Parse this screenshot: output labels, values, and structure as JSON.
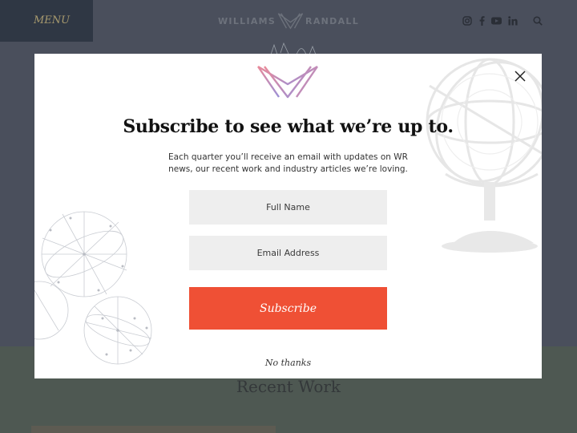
{
  "header": {
    "menu_label": "MENU",
    "logo": {
      "left_word": "WILLIAMS",
      "right_word": "RANDALL"
    },
    "social_icons": [
      "instagram-icon",
      "facebook-icon",
      "youtube-icon",
      "linkedin-icon",
      "search-icon"
    ]
  },
  "page": {
    "section_title": "Recent Work"
  },
  "modal": {
    "heading": "Subscribe to see what we’re up to.",
    "description": "Each quarter you’ll receive an email with updates on WR news, our recent work and industry articles we’re loving.",
    "full_name_placeholder": "Full Name",
    "email_placeholder": "Email Address",
    "subscribe_label": "Subscribe",
    "decline_label": "No thanks"
  },
  "colors": {
    "header_background": "#4a4f5c",
    "menu_background": "#2f3744",
    "accent_button": "#ef5035",
    "logo_gradient_start": "#e88a9a",
    "logo_gradient_end": "#9b8fd6"
  }
}
